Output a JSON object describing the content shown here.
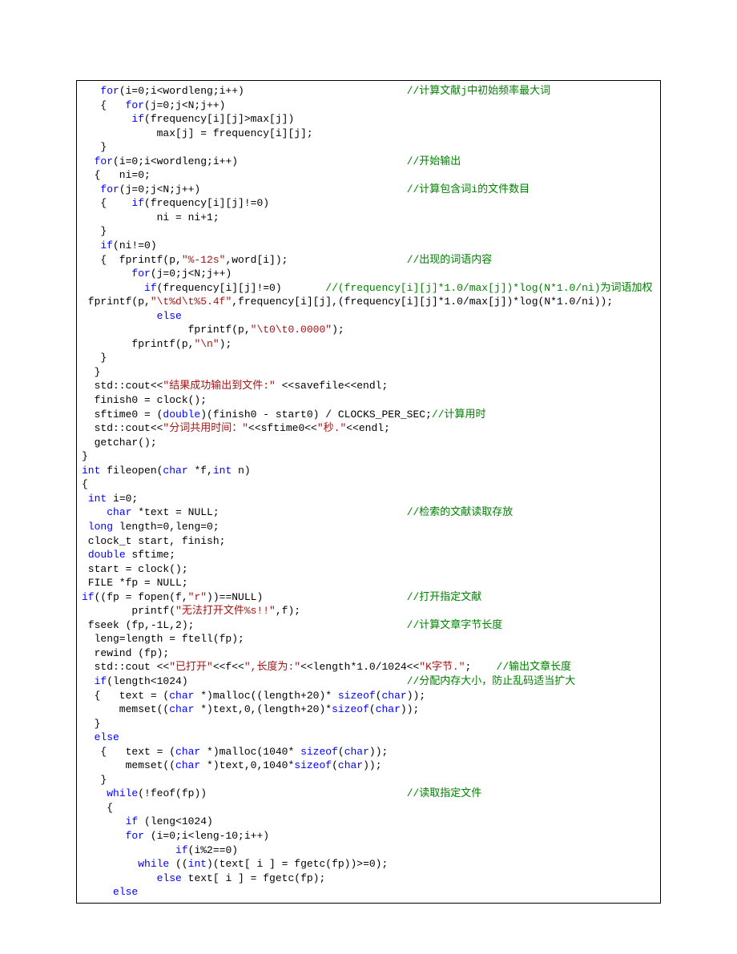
{
  "code": {
    "lines": [
      {
        "indent": "   ",
        "segs": [
          {
            "c": "kw",
            "t": "for"
          },
          {
            "c": "pl",
            "t": "(i=0;i<wordleng;i++)"
          }
        ],
        "comment": "//计算文献j中初始频率最大词",
        "commentCol": 52
      },
      {
        "indent": "   {   ",
        "segs": [
          {
            "c": "kw",
            "t": "for"
          },
          {
            "c": "pl",
            "t": "(j=0;j<N;j++)"
          }
        ]
      },
      {
        "indent": "        ",
        "segs": [
          {
            "c": "kw",
            "t": "if"
          },
          {
            "c": "pl",
            "t": "(frequency[i][j]>max[j])"
          }
        ]
      },
      {
        "indent": "            ",
        "segs": [
          {
            "c": "pl",
            "t": "max[j] = frequency[i][j];"
          }
        ]
      },
      {
        "indent": "   }",
        "segs": []
      },
      {
        "indent": "",
        "segs": []
      },
      {
        "indent": "  ",
        "segs": [
          {
            "c": "kw",
            "t": "for"
          },
          {
            "c": "pl",
            "t": "(i=0;i<wordleng;i++)"
          }
        ],
        "comment": "//开始输出",
        "commentCol": 52
      },
      {
        "indent": "  {   ni=0;",
        "segs": []
      },
      {
        "indent": "   ",
        "segs": [
          {
            "c": "kw",
            "t": "for"
          },
          {
            "c": "pl",
            "t": "(j=0;j<N;j++)"
          }
        ],
        "comment": "//计算包含词i的文件数目",
        "commentCol": 52
      },
      {
        "indent": "   {    ",
        "segs": [
          {
            "c": "kw",
            "t": "if"
          },
          {
            "c": "pl",
            "t": "(frequency[i][j]!=0)"
          }
        ]
      },
      {
        "indent": "            ",
        "segs": [
          {
            "c": "pl",
            "t": "ni = ni+1;"
          }
        ]
      },
      {
        "indent": "   }",
        "segs": []
      },
      {
        "indent": "   ",
        "segs": [
          {
            "c": "kw",
            "t": "if"
          },
          {
            "c": "pl",
            "t": "(ni!=0)"
          }
        ]
      },
      {
        "indent": "   {  fprintf(p,",
        "segs": [
          {
            "c": "str",
            "t": "\"%-12s\""
          },
          {
            "c": "pl",
            "t": ",word[i]);"
          }
        ],
        "comment": "//出现的词语内容",
        "commentCol": 52
      },
      {
        "indent": "        ",
        "segs": [
          {
            "c": "kw",
            "t": "for"
          },
          {
            "c": "pl",
            "t": "(j=0;j<N;j++)"
          }
        ]
      },
      {
        "indent": "          ",
        "segs": [
          {
            "c": "kw",
            "t": "if"
          },
          {
            "c": "pl",
            "t": "(frequency[i][j]!=0)"
          }
        ],
        "comment": "//(frequency[i][j]*1.0/max[j])*log(N*1.0/ni)为词语加权",
        "commentCol": 39
      },
      {
        "indent": "",
        "segs": []
      },
      {
        "indent": " fprintf(p,",
        "segs": [
          {
            "c": "str",
            "t": "\"\\t%d\\t%5.4f\""
          },
          {
            "c": "pl",
            "t": ",frequency[i][j],(frequency[i][j]*1.0/max[j])*log(N*1.0/ni));"
          }
        ]
      },
      {
        "indent": "            ",
        "segs": [
          {
            "c": "kw",
            "t": "else"
          }
        ]
      },
      {
        "indent": "                 fprintf(p,",
        "segs": [
          {
            "c": "str",
            "t": "\"\\t0\\t0.0000\""
          },
          {
            "c": "pl",
            "t": ");"
          }
        ]
      },
      {
        "indent": "        fprintf(p,",
        "segs": [
          {
            "c": "str",
            "t": "\"\\n\""
          },
          {
            "c": "pl",
            "t": ");"
          }
        ]
      },
      {
        "indent": "   }",
        "segs": []
      },
      {
        "indent": "  }",
        "segs": []
      },
      {
        "indent": "  std::cout<<",
        "segs": [
          {
            "c": "str",
            "t": "\"结果成功输出到文件:\""
          },
          {
            "c": "pl",
            "t": " <<savefile<<endl;"
          }
        ]
      },
      {
        "indent": "  finish0 = clock();",
        "segs": []
      },
      {
        "indent": "  sftime0 = (",
        "segs": [
          {
            "c": "kw",
            "t": "double"
          },
          {
            "c": "pl",
            "t": ")(finish0 - start0) / CLOCKS_PER_SEC;"
          },
          {
            "c": "cm",
            "t": "//计算用时"
          }
        ]
      },
      {
        "indent": "  std::cout<<",
        "segs": [
          {
            "c": "str",
            "t": "\"分词共用时间：\""
          },
          {
            "c": "pl",
            "t": "<<sftime0<<"
          },
          {
            "c": "str",
            "t": "\"秒.\""
          },
          {
            "c": "pl",
            "t": "<<endl;"
          }
        ]
      },
      {
        "indent": "  getchar();",
        "segs": []
      },
      {
        "indent": "}",
        "segs": []
      },
      {
        "indent": "",
        "segs": []
      },
      {
        "indent": "",
        "segs": [
          {
            "c": "kw",
            "t": "int"
          },
          {
            "c": "pl",
            "t": " fileopen("
          },
          {
            "c": "kw",
            "t": "char"
          },
          {
            "c": "pl",
            "t": " *f,"
          },
          {
            "c": "kw",
            "t": "int"
          },
          {
            "c": "pl",
            "t": " n)"
          }
        ]
      },
      {
        "indent": "{",
        "segs": []
      },
      {
        "indent": " ",
        "segs": [
          {
            "c": "kw",
            "t": "int"
          },
          {
            "c": "pl",
            "t": " i=0;"
          }
        ]
      },
      {
        "indent": "    ",
        "segs": [
          {
            "c": "kw",
            "t": "char"
          },
          {
            "c": "pl",
            "t": " *text = NULL;"
          }
        ],
        "comment": "//检索的文献读取存放",
        "commentCol": 52
      },
      {
        "indent": " ",
        "segs": [
          {
            "c": "kw",
            "t": "long"
          },
          {
            "c": "pl",
            "t": " length=0,leng=0;"
          }
        ]
      },
      {
        "indent": " clock_t start, finish;",
        "segs": []
      },
      {
        "indent": " ",
        "segs": [
          {
            "c": "kw",
            "t": "double"
          },
          {
            "c": "pl",
            "t": " sftime;"
          }
        ]
      },
      {
        "indent": " start = clock();",
        "segs": []
      },
      {
        "indent": "",
        "segs": []
      },
      {
        "indent": " FILE *fp = NULL;",
        "segs": []
      },
      {
        "indent": "",
        "segs": [
          {
            "c": "kw",
            "t": "if"
          },
          {
            "c": "pl",
            "t": "((fp = fopen(f,"
          },
          {
            "c": "str",
            "t": "\"r\""
          },
          {
            "c": "pl",
            "t": "))==NULL)"
          }
        ],
        "comment": "//打开指定文献",
        "commentCol": 52
      },
      {
        "indent": "        printf(",
        "segs": [
          {
            "c": "str",
            "t": "\"无法打开文件%s!!\""
          },
          {
            "c": "pl",
            "t": ",f);"
          }
        ]
      },
      {
        "indent": " fseek (fp,-1L,2);",
        "segs": [],
        "comment": "//计算文章字节长度",
        "commentCol": 52
      },
      {
        "indent": "  leng=length = ftell(fp);",
        "segs": []
      },
      {
        "indent": "  rewind (fp);",
        "segs": []
      },
      {
        "indent": "  std::cout <<",
        "segs": [
          {
            "c": "str",
            "t": "\"已打开\""
          },
          {
            "c": "pl",
            "t": "<<f<<"
          },
          {
            "c": "str",
            "t": "\",长度为:\""
          },
          {
            "c": "pl",
            "t": "<<length*1.0/1024<<"
          },
          {
            "c": "str",
            "t": "\"K字节.\""
          },
          {
            "c": "pl",
            "t": ";    "
          },
          {
            "c": "cm",
            "t": "//输出文章长度"
          }
        ]
      },
      {
        "indent": "",
        "segs": []
      },
      {
        "indent": "  ",
        "segs": [
          {
            "c": "kw",
            "t": "if"
          },
          {
            "c": "pl",
            "t": "(length<1024)"
          }
        ],
        "comment": "//分配内存大小，防止乱码适当扩大",
        "commentCol": 52
      },
      {
        "indent": "  {   text = (",
        "segs": [
          {
            "c": "kw",
            "t": "char"
          },
          {
            "c": "pl",
            "t": " *)malloc((length+20)* "
          },
          {
            "c": "kw",
            "t": "sizeof"
          },
          {
            "c": "pl",
            "t": "("
          },
          {
            "c": "kw",
            "t": "char"
          },
          {
            "c": "pl",
            "t": "));"
          }
        ]
      },
      {
        "indent": "      memset((",
        "segs": [
          {
            "c": "kw",
            "t": "char"
          },
          {
            "c": "pl",
            "t": " *)text,0,(length+20)*"
          },
          {
            "c": "kw",
            "t": "sizeof"
          },
          {
            "c": "pl",
            "t": "("
          },
          {
            "c": "kw",
            "t": "char"
          },
          {
            "c": "pl",
            "t": "));"
          }
        ]
      },
      {
        "indent": "  }",
        "segs": []
      },
      {
        "indent": "  ",
        "segs": [
          {
            "c": "kw",
            "t": "else"
          }
        ]
      },
      {
        "indent": "   {   text = (",
        "segs": [
          {
            "c": "kw",
            "t": "char"
          },
          {
            "c": "pl",
            "t": " *)malloc(1040* "
          },
          {
            "c": "kw",
            "t": "sizeof"
          },
          {
            "c": "pl",
            "t": "("
          },
          {
            "c": "kw",
            "t": "char"
          },
          {
            "c": "pl",
            "t": "));"
          }
        ]
      },
      {
        "indent": "       memset((",
        "segs": [
          {
            "c": "kw",
            "t": "char"
          },
          {
            "c": "pl",
            "t": " *)text,0,1040*"
          },
          {
            "c": "kw",
            "t": "sizeof"
          },
          {
            "c": "pl",
            "t": "("
          },
          {
            "c": "kw",
            "t": "char"
          },
          {
            "c": "pl",
            "t": "));"
          }
        ]
      },
      {
        "indent": "   }",
        "segs": []
      },
      {
        "indent": "",
        "segs": []
      },
      {
        "indent": "    ",
        "segs": [
          {
            "c": "kw",
            "t": "while"
          },
          {
            "c": "pl",
            "t": "(!feof(fp))"
          }
        ],
        "comment": "//读取指定文件",
        "commentCol": 52
      },
      {
        "indent": "    {",
        "segs": []
      },
      {
        "indent": "       ",
        "segs": [
          {
            "c": "kw",
            "t": "if"
          },
          {
            "c": "pl",
            "t": " (leng<1024)"
          }
        ]
      },
      {
        "indent": "       ",
        "segs": [
          {
            "c": "kw",
            "t": "for"
          },
          {
            "c": "pl",
            "t": " (i=0;i<leng-10;i++)"
          }
        ]
      },
      {
        "indent": "               ",
        "segs": [
          {
            "c": "kw",
            "t": "if"
          },
          {
            "c": "pl",
            "t": "(i%2==0)"
          }
        ]
      },
      {
        "indent": "         ",
        "segs": [
          {
            "c": "kw",
            "t": "while"
          },
          {
            "c": "pl",
            "t": " (("
          },
          {
            "c": "kw",
            "t": "int"
          },
          {
            "c": "pl",
            "t": ")(text[ i ] = fgetc(fp))>=0);"
          }
        ]
      },
      {
        "indent": "            ",
        "segs": [
          {
            "c": "kw",
            "t": "else"
          },
          {
            "c": "pl",
            "t": " text[ i ] = fgetc(fp);"
          }
        ]
      },
      {
        "indent": "     ",
        "segs": [
          {
            "c": "kw",
            "t": "else"
          }
        ]
      }
    ]
  }
}
